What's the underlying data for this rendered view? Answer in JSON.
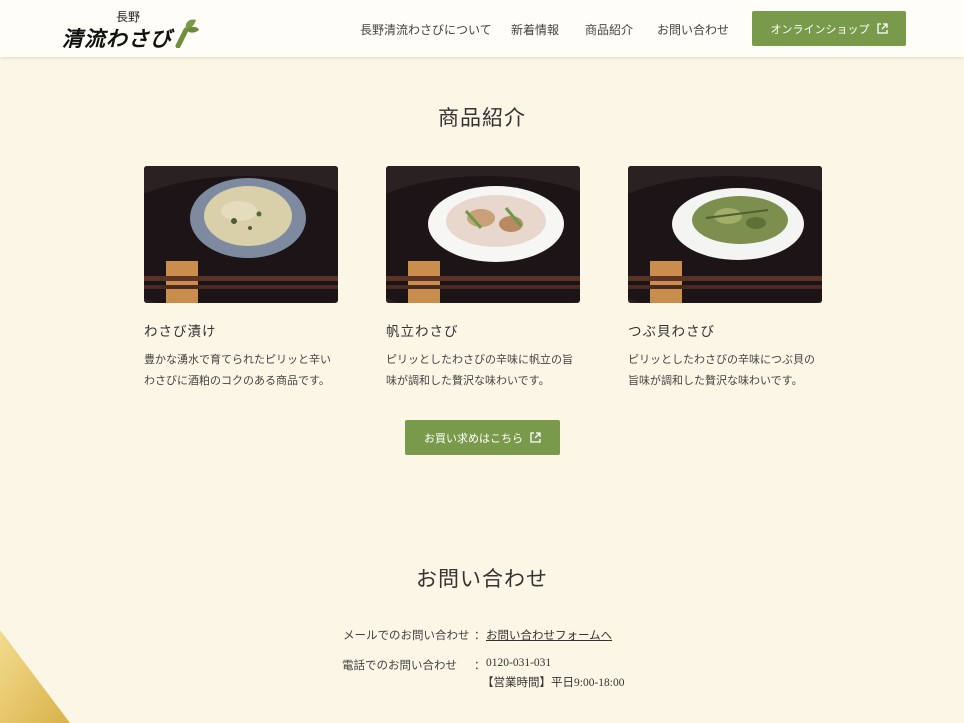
{
  "header": {
    "logo_sub": "長野",
    "logo_main": "清流わさび",
    "nav": [
      "長野清流わさびについて",
      "新着情報",
      "商品紹介",
      "お問い合わせ"
    ],
    "shop_label": "オンラインショップ"
  },
  "products": {
    "title": "商品紹介",
    "items": [
      {
        "name": "わさび漬け",
        "desc1": "豊かな湧水で育てられたピリッと辛い",
        "desc2": "わさびに酒粕のコクのある商品です。"
      },
      {
        "name": "帆立わさび",
        "desc1": "ピリッとしたわさびの辛味に帆立の旨",
        "desc2": "味が調和した贅沢な味わいです。"
      },
      {
        "name": "つぶ貝わさび",
        "desc1": "ピリッとしたわさびの辛味につぶ貝の",
        "desc2": "旨味が調和した贅沢な味わいです。"
      }
    ],
    "buy_label": "お買い求めはこちら"
  },
  "contact": {
    "title": "お問い合わせ",
    "mail_label": "メールでのお問い合わせ",
    "mail_link": "お問い合わせフォームへ",
    "phone_label": "電話でのお問い合わせ",
    "phone_number": "0120-031-031",
    "hours": "【営業時間】平日9:00-18:00",
    "colon": "："
  },
  "colors": {
    "accent": "#7a9a4b",
    "background": "#fcf6e6"
  }
}
